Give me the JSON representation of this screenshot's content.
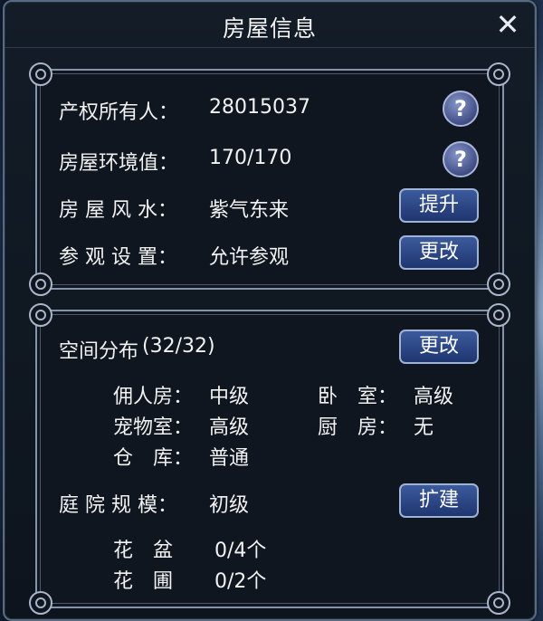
{
  "title": "房屋信息",
  "close_label": "✕",
  "house": {
    "owner_label": "产权所有人：",
    "owner_value": "28015037",
    "env_label": "房屋环境值：",
    "env_value": "170/170",
    "fengshui_label": "房 屋 风 水：",
    "fengshui_value": "紫气东来",
    "fengshui_button": "提升",
    "visit_label": "参 观 设 置：",
    "visit_value": "允许参观",
    "visit_button": "更改",
    "help_label": "?"
  },
  "space": {
    "label": "空间分布",
    "count": "(32/32)",
    "change_button": "更改",
    "rooms": [
      {
        "label": "佣人房：",
        "value": "中级"
      },
      {
        "label": "卧　室：",
        "value": "高级"
      },
      {
        "label": "宠物室：",
        "value": "高级"
      },
      {
        "label": "厨　房：",
        "value": "无"
      },
      {
        "label": "仓　库：",
        "value": "普通"
      }
    ],
    "yard_label": "庭 院 规 模：",
    "yard_value": "初级",
    "yard_button": "扩建",
    "items": [
      {
        "label": "花　盆",
        "value": "0/4个"
      },
      {
        "label": "花　圃",
        "value": "0/2个"
      }
    ]
  }
}
